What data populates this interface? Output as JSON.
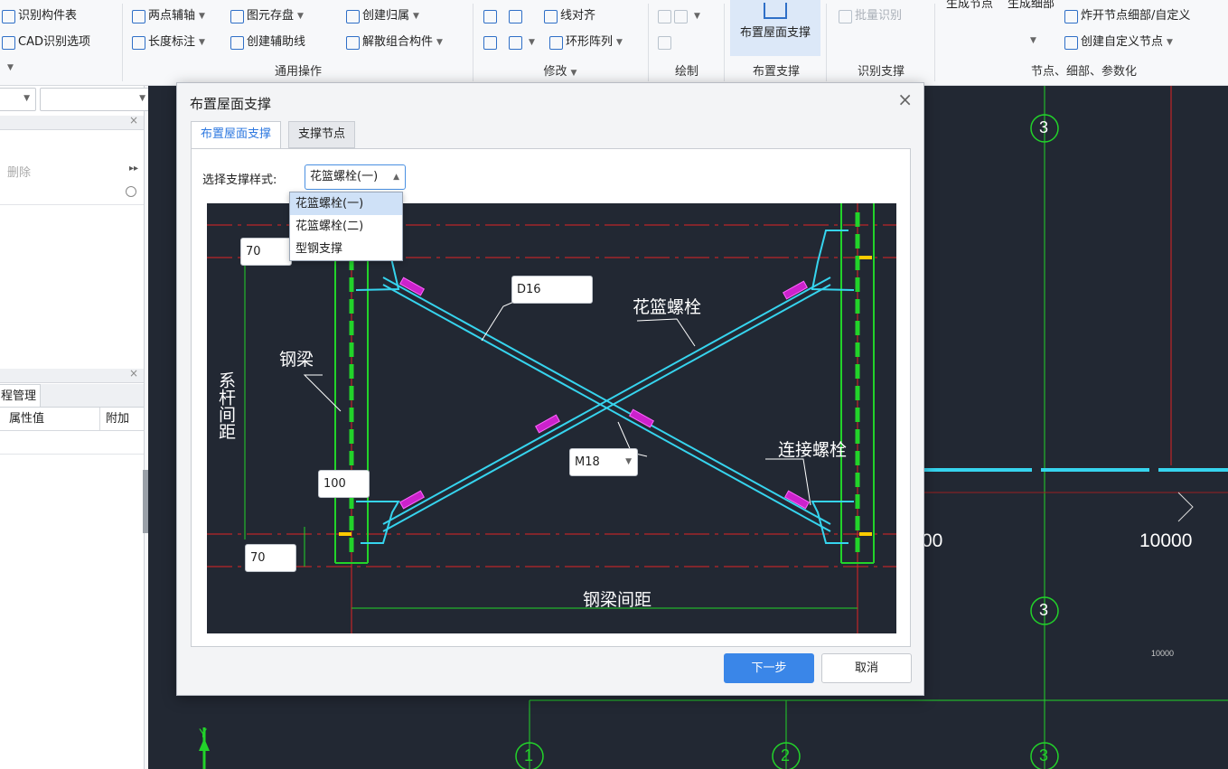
{
  "ribbon": {
    "items": {
      "identify_component_table": "识别构件表",
      "cad_identify_options": "CAD识别选项",
      "two_point_axis": "两点辅轴",
      "length_dimension": "长度标注",
      "element_save": "图元存盘",
      "create_aux_line": "创建辅助线",
      "create_group": "创建归属",
      "explode_group": "解散组合构件",
      "line_align": "线对齐",
      "ring_array": "环形阵列",
      "batch_identify": "批量识别",
      "explode_node_detail": "炸开节点细部/自定义",
      "create_custom_node": "创建自定义节点"
    },
    "big_buttons": {
      "place_roof_bracing": "布置屋面支撑",
      "generate_node": "生成节点",
      "generate_detail": "生成细部"
    },
    "groups": {
      "common_ops": "通用操作",
      "modify": "修改",
      "draw": "绘制",
      "place_bracing": "布置支撑",
      "identify_bracing": "识别支撑",
      "node_detail_param": "节点、细部、参数化"
    }
  },
  "left_panel": {
    "delete_label": "删除",
    "tab_label": "程管理",
    "col_attr_value": "属性值",
    "col_extra": "附加"
  },
  "canvas": {
    "axis_labels": [
      "3",
      "3",
      "1",
      "2",
      "3"
    ],
    "dim_10000": "10000",
    "dim_partial": "00",
    "small_dim": "10000",
    "y_axis": "Y"
  },
  "dialog": {
    "title": "布置屋面支撑",
    "tabs": [
      "布置屋面支撑",
      "支撑节点"
    ],
    "style_label": "选择支撑样式:",
    "style_selected": "花篮螺栓(一)",
    "style_options": [
      "花篮螺栓(一)",
      "花篮螺栓(二)",
      "型钢支撑"
    ],
    "drawing": {
      "dim_top": "70",
      "rod_dia": "D16",
      "dim_mid": "100",
      "bolt": "M18",
      "dim_bottom": "70",
      "lbl_turnbuckle": "花篮螺栓",
      "lbl_steel_beam": "钢梁",
      "lbl_purlin_spacing": "系杆间距",
      "lbl_conn_bolt": "连接螺栓",
      "lbl_beam_spacing": "钢梁间距"
    },
    "next_button": "下一步",
    "cancel_button": "取消"
  },
  "colors": {
    "accent": "#3a86e8",
    "cad_bg": "#222833",
    "cad_green": "#22d32a",
    "cad_cyan": "#36d4ee",
    "cad_red": "#e02424"
  }
}
